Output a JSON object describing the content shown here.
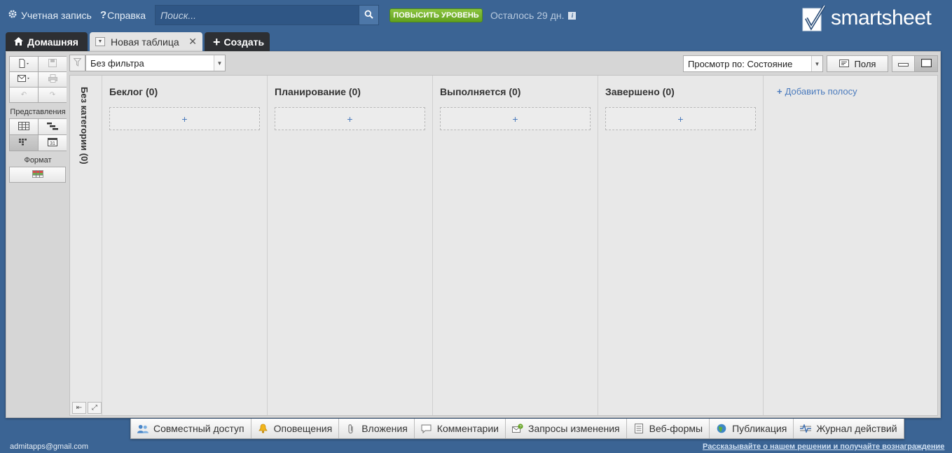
{
  "topbar": {
    "account_label": "Учетная запись",
    "help_label": "Справка",
    "search_placeholder": "Поиск...",
    "upgrade_label": "ПОВЫСИТЬ УРОВЕНЬ",
    "trial_text": "Осталось 29 дн.",
    "logo_text": "smartsheet",
    "info_glyph": "i"
  },
  "tabs": {
    "home": "Домашняя",
    "sheet": "Новая таблица",
    "create": "Создать"
  },
  "sidebar": {
    "views_label": "Представления",
    "format_label": "Формат"
  },
  "toolbar": {
    "filter_value": "Без фильтра",
    "view_by_value": "Просмотр по: Состояние",
    "fields_label": "Поля"
  },
  "board": {
    "uncategorized_label": "Без категории (0)",
    "lanes": [
      {
        "title": "Беклог (0)"
      },
      {
        "title": "Планирование (0)"
      },
      {
        "title": "Выполняется (0)"
      },
      {
        "title": "Завершено (0)"
      }
    ],
    "add_card_glyph": "+",
    "add_lane_label": "Добавить полосу"
  },
  "bottombar": {
    "items": [
      {
        "label": "Совместный доступ",
        "icon": "people-icon"
      },
      {
        "label": "Оповещения",
        "icon": "bell-icon"
      },
      {
        "label": "Вложения",
        "icon": "paperclip-icon"
      },
      {
        "label": "Комментарии",
        "icon": "comment-icon"
      },
      {
        "label": "Запросы изменения",
        "icon": "update-request-icon"
      },
      {
        "label": "Веб-формы",
        "icon": "form-icon"
      },
      {
        "label": "Публикация",
        "icon": "globe-icon"
      },
      {
        "label": "Журнал действий",
        "icon": "activity-log-icon"
      }
    ]
  },
  "footer": {
    "user_email": "admitapps@gmail.com",
    "promo_link": "Рассказывайте о нашем решении и получайте вознаграждение"
  },
  "colors": {
    "background": "#3b6494",
    "upgrade": "#7ab632",
    "link": "#4b7bbd"
  }
}
